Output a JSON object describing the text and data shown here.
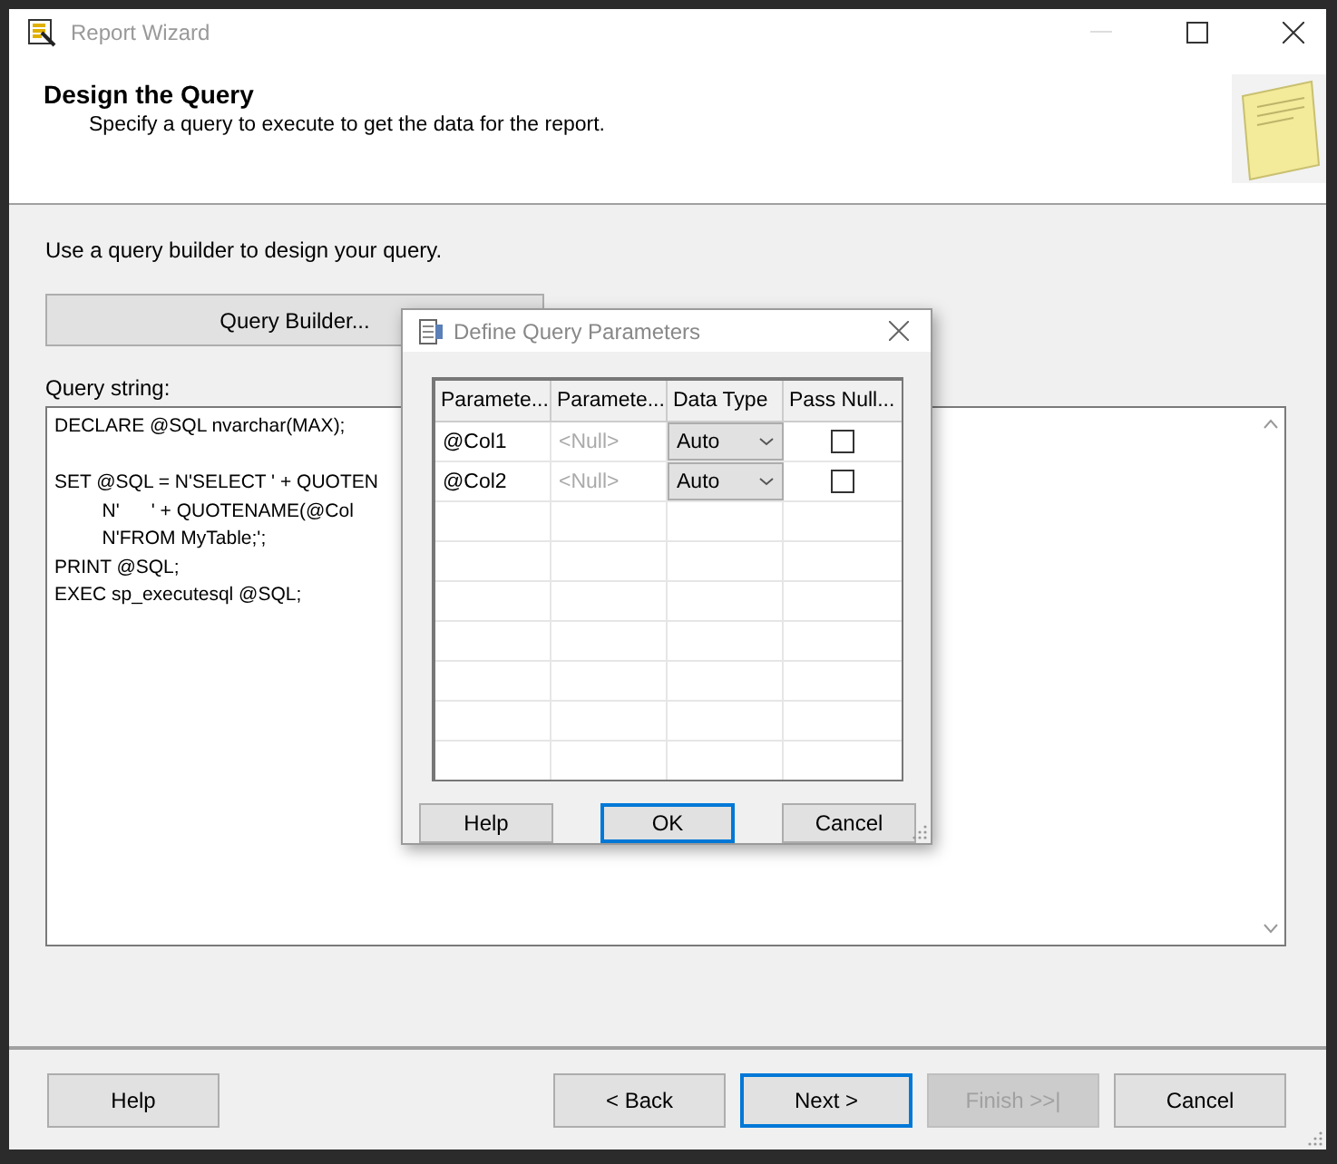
{
  "window": {
    "title": "Report Wizard"
  },
  "header": {
    "title": "Design the Query",
    "subtitle": "Specify a query to execute to get the data for the report."
  },
  "instruction": "Use a query builder to design your query.",
  "query_builder_button": "Query Builder...",
  "query_label": "Query string:",
  "query_paragraphs": [
    [
      "DECLARE @SQL nvarchar(MAX);"
    ],
    [
      "SET @SQL = N'SELECT ' + QUOTEN",
      "         N'      ' + QUOTENAME(@Col",
      "         N'FROM MyTable;';",
      "PRINT @SQL;",
      "EXEC sp_executesql @SQL;"
    ]
  ],
  "dialog": {
    "title": "Define Query Parameters",
    "columns": [
      "Paramete...",
      "Paramete...",
      "Data Type",
      "Pass Null..."
    ],
    "rows": [
      {
        "name": "@Col1",
        "value": "<Null>",
        "data_type": "Auto",
        "pass_null": false
      },
      {
        "name": "@Col2",
        "value": "<Null>",
        "data_type": "Auto",
        "pass_null": false
      }
    ],
    "buttons": [
      {
        "label": "Help",
        "default": false
      },
      {
        "label": "OK",
        "default": true
      },
      {
        "label": "Cancel",
        "default": false
      }
    ]
  },
  "buttons": [
    {
      "label": "Help",
      "default": false,
      "disabled": false
    },
    {
      "label": "< Back",
      "default": false,
      "disabled": false
    },
    {
      "label": "Next >",
      "default": true,
      "disabled": false
    },
    {
      "label": "Finish >>|",
      "default": false,
      "disabled": true
    },
    {
      "label": "Cancel",
      "default": false,
      "disabled": false
    }
  ]
}
